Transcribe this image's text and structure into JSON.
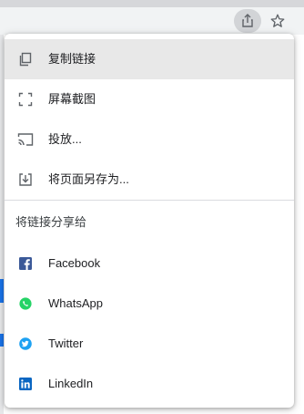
{
  "menu": {
    "items": [
      {
        "label": "复制链接",
        "icon": "copy-icon"
      },
      {
        "label": "屏幕截图",
        "icon": "screenshot-icon"
      },
      {
        "label": "投放...",
        "icon": "cast-icon"
      },
      {
        "label": "将页面另存为...",
        "icon": "save-page-icon"
      }
    ],
    "share_section_title": "将链接分享给",
    "share_targets": [
      {
        "label": "Facebook",
        "icon": "facebook-icon",
        "color": "#3b5998"
      },
      {
        "label": "WhatsApp",
        "icon": "whatsapp-icon",
        "color": "#25d366"
      },
      {
        "label": "Twitter",
        "icon": "twitter-icon",
        "color": "#1da1f2"
      },
      {
        "label": "LinkedIn",
        "icon": "linkedin-icon",
        "color": "#0a66c2"
      }
    ]
  },
  "toolbar": {
    "share_icon": "share-icon",
    "bookmark_icon": "star-icon"
  }
}
